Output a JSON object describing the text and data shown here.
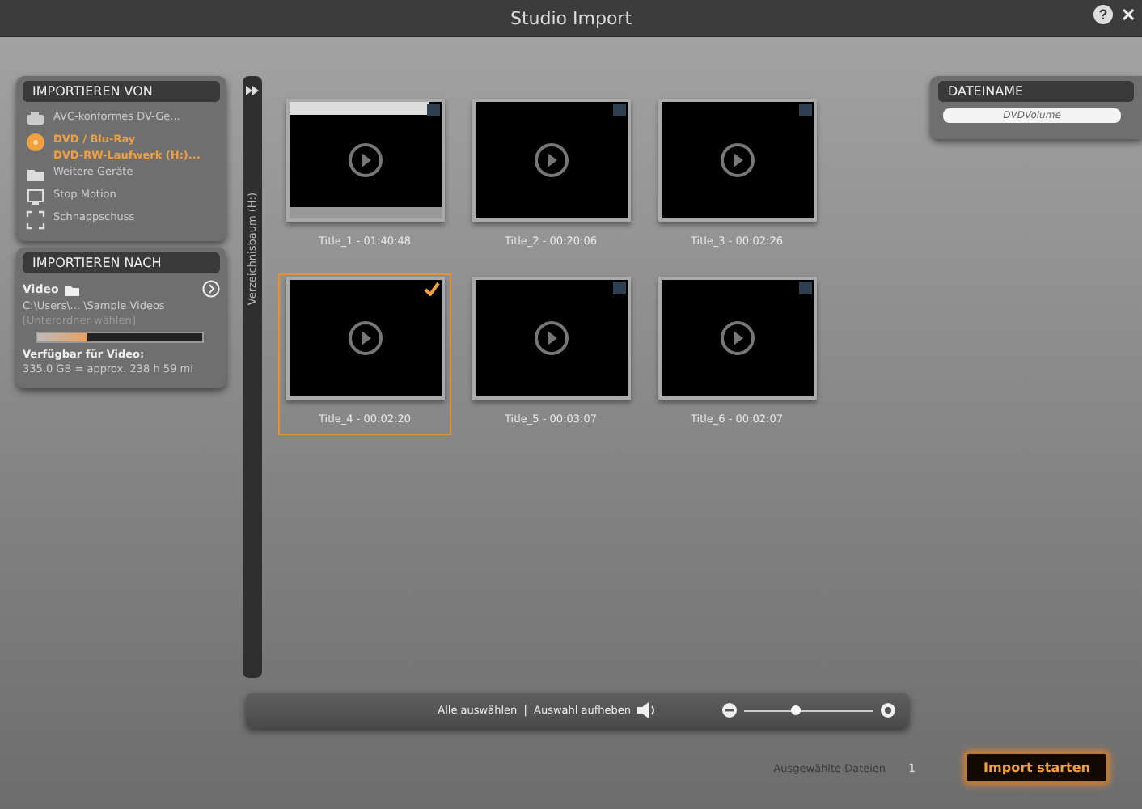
{
  "window": {
    "title": "Studio Import",
    "buttons": [
      "?",
      "✕"
    ]
  },
  "import_from": {
    "title": "IMPORTIEREN VON",
    "items": [
      {
        "kind": "camera",
        "label": "AVC-konformes DV-Ge...",
        "selected": false
      },
      {
        "kind": "disc",
        "label": "DVD / Blu-Ray",
        "sub": "DVD-RW-Laufwerk (H:)...",
        "selected": true
      },
      {
        "kind": "folder",
        "label": "Weitere Geräte",
        "selected": false
      },
      {
        "kind": "stopmotion",
        "label": "Stop Motion",
        "selected": false
      },
      {
        "kind": "snapshot",
        "label": "Schnappschuss",
        "selected": false
      }
    ]
  },
  "import_to": {
    "title": "IMPORTIEREN NACH",
    "type": "Video",
    "path": "C:\\Users\\... \\Sample Videos",
    "subfolder": "[Unterordner wählen]",
    "level": 0.3,
    "available_label": "Verfügbar für Video:",
    "available": "335.0 GB = approx. 238 h 59 mi"
  },
  "tree_strip": {
    "label": "Verzeichnisbaum (H:)"
  },
  "titles": [
    {
      "label": "Title_1 - 01:40:48",
      "selected": false,
      "loading": true
    },
    {
      "label": "Title_2 - 00:20:06",
      "selected": false,
      "loading": false
    },
    {
      "label": "Title_3 - 00:02:26",
      "selected": false,
      "loading": false
    },
    {
      "label": "Title_4 - 00:02:20",
      "selected": true,
      "loading": false
    },
    {
      "label": "Title_5 - 00:03:07",
      "selected": false,
      "loading": false
    },
    {
      "label": "Title_6 - 00:02:07",
      "selected": false,
      "loading": false
    }
  ],
  "toolbar": {
    "select_all": "Alle auswählen",
    "separator": "|",
    "deselect": "Auswahl aufheben",
    "zoom": {
      "level": 0.4
    }
  },
  "filename": {
    "title": "DATEINAME",
    "value": "DVDVolume"
  },
  "footer": {
    "selected_label": "Ausgewählte Dateien",
    "selected_count": "1",
    "button": "Import starten"
  }
}
